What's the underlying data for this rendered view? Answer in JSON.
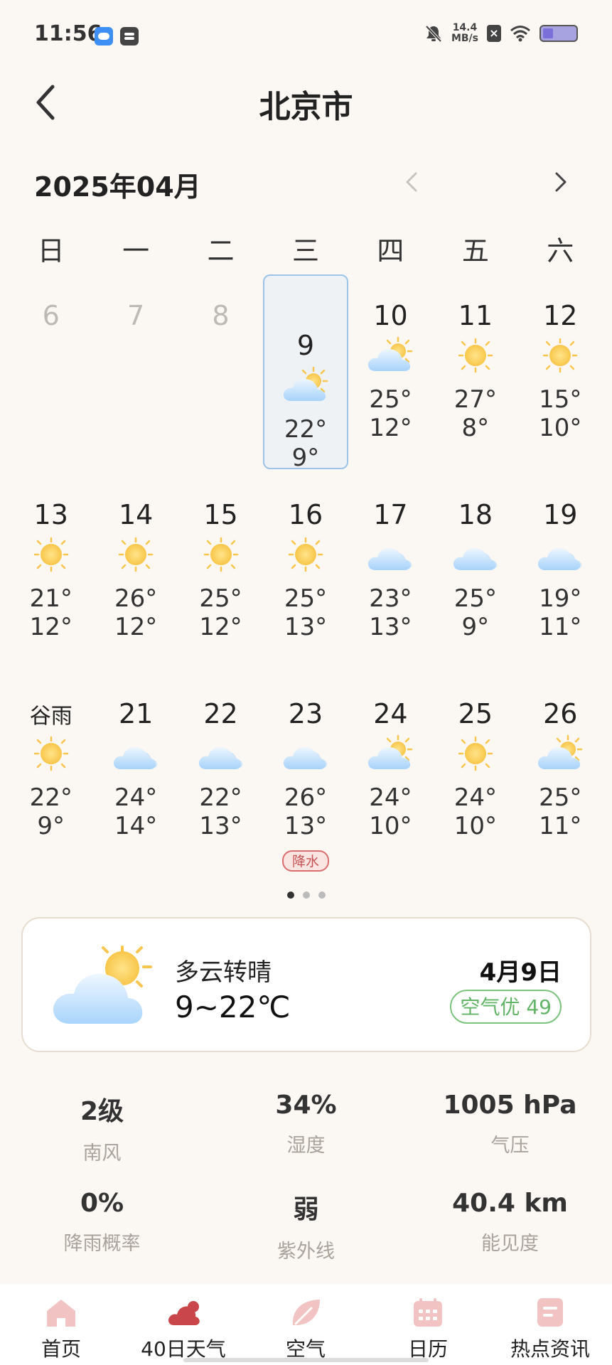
{
  "status_bar": {
    "time": "11:56",
    "net_speed_value": "14.4",
    "net_speed_unit": "MB/s",
    "icons": [
      "weather-app-icon",
      "calendar-app-icon",
      "mute-icon",
      "sim-x-icon",
      "wifi-icon",
      "battery-icon"
    ]
  },
  "header": {
    "title": "北京市"
  },
  "calendar": {
    "month_label": "2025年04月",
    "weekdays": [
      "日",
      "一",
      "二",
      "三",
      "四",
      "五",
      "六"
    ],
    "weeks": [
      [
        {
          "day": "6",
          "muted": true
        },
        {
          "day": "7",
          "muted": true
        },
        {
          "day": "8",
          "muted": true
        },
        {
          "day": "9",
          "icon": "partly-cloudy",
          "hi": "22°",
          "lo": "9°",
          "selected": true
        },
        {
          "day": "10",
          "icon": "partly-cloudy",
          "hi": "25°",
          "lo": "12°"
        },
        {
          "day": "11",
          "icon": "sunny",
          "hi": "27°",
          "lo": "8°"
        },
        {
          "day": "12",
          "icon": "sunny",
          "hi": "15°",
          "lo": "10°"
        }
      ],
      [
        {
          "day": "13",
          "icon": "sunny",
          "hi": "21°",
          "lo": "12°"
        },
        {
          "day": "14",
          "icon": "sunny",
          "hi": "26°",
          "lo": "12°"
        },
        {
          "day": "15",
          "icon": "sunny",
          "hi": "25°",
          "lo": "12°"
        },
        {
          "day": "16",
          "icon": "sunny",
          "hi": "25°",
          "lo": "13°"
        },
        {
          "day": "17",
          "icon": "cloudy",
          "hi": "23°",
          "lo": "13°"
        },
        {
          "day": "18",
          "icon": "cloudy",
          "hi": "25°",
          "lo": "9°"
        },
        {
          "day": "19",
          "icon": "cloudy",
          "hi": "19°",
          "lo": "11°"
        }
      ],
      [
        {
          "day": "谷雨",
          "term": true,
          "icon": "sunny",
          "hi": "22°",
          "lo": "9°"
        },
        {
          "day": "21",
          "icon": "cloudy",
          "hi": "24°",
          "lo": "14°"
        },
        {
          "day": "22",
          "icon": "cloudy",
          "hi": "22°",
          "lo": "13°"
        },
        {
          "day": "23",
          "icon": "cloudy",
          "hi": "26°",
          "lo": "13°",
          "badge": "降水"
        },
        {
          "day": "24",
          "icon": "partly-cloudy",
          "hi": "24°",
          "lo": "10°"
        },
        {
          "day": "25",
          "icon": "sunny",
          "hi": "24°",
          "lo": "10°"
        },
        {
          "day": "26",
          "icon": "partly-cloudy",
          "hi": "25°",
          "lo": "11°"
        }
      ]
    ],
    "pages": 3,
    "active_page": 0
  },
  "summary": {
    "icon": "partly-cloudy",
    "description": "多云转晴",
    "temp_range": "9~22℃",
    "date": "4月9日",
    "aqi": "空气优 49"
  },
  "stats": [
    [
      {
        "value": "2级",
        "label": "南风"
      },
      {
        "value": "34%",
        "label": "湿度"
      },
      {
        "value": "1005 hPa",
        "label": "气压"
      }
    ],
    [
      {
        "value": "0%",
        "label": "降雨概率"
      },
      {
        "value": "弱",
        "label": "紫外线"
      },
      {
        "value": "40.4 km",
        "label": "能见度"
      }
    ]
  ],
  "bottom_nav": [
    {
      "label": "首页",
      "icon": "home-icon",
      "color": "#f2c3c3"
    },
    {
      "label": "40日天气",
      "icon": "cloud-icon",
      "color": "#c9474a",
      "active": true
    },
    {
      "label": "空气",
      "icon": "leaf-icon",
      "color": "#f2c3c3"
    },
    {
      "label": "日历",
      "icon": "calendar-icon",
      "color": "#f2c3c3"
    },
    {
      "label": "热点资讯",
      "icon": "news-icon",
      "color": "#f2c3c3"
    }
  ],
  "colors": {
    "background": "#fbf7f2",
    "selected_border": "#9cc4e8",
    "aqi_green": "#62b566",
    "rain_red": "#c75252"
  }
}
